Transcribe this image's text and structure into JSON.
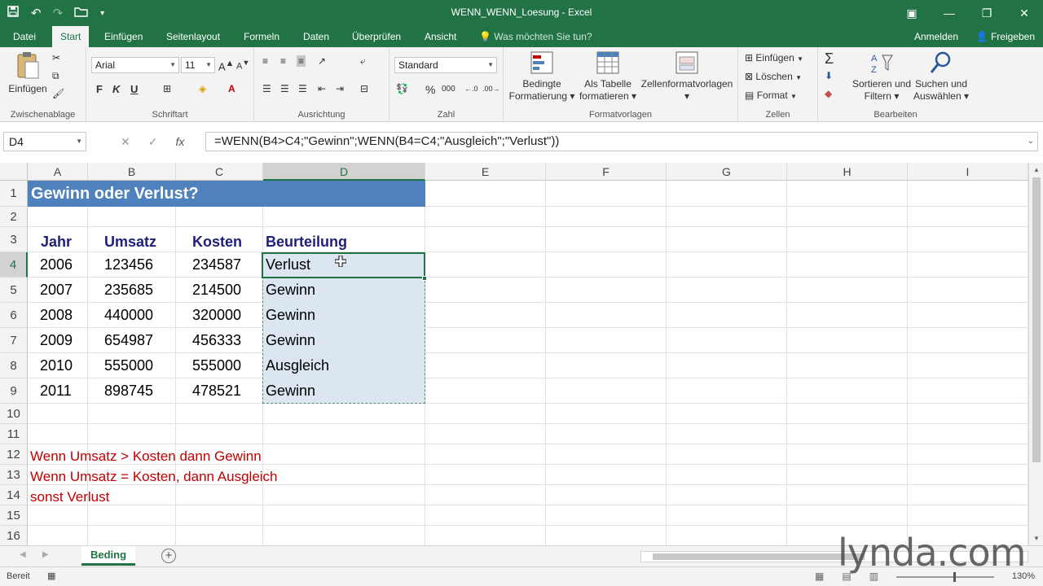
{
  "window": {
    "title": "WENN_WENN_Loesung - Excel",
    "qat": {
      "save_icon": "save-icon",
      "undo_icon": "undo-icon",
      "redo_icon": "redo-icon",
      "open_icon": "open-folder-icon",
      "customize_icon": "customize-icon"
    }
  },
  "ribbon_tabs": [
    "Datei",
    "Start",
    "Einfügen",
    "Seitenlayout",
    "Formeln",
    "Daten",
    "Überprüfen",
    "Ansicht"
  ],
  "active_tab": "Start",
  "tell_me": "Was möchten Sie tun?",
  "account": {
    "signin": "Anmelden",
    "share": "Freigeben"
  },
  "ribbon": {
    "clipboard": {
      "paste": "Einfügen",
      "label": "Zwischenablage"
    },
    "font": {
      "name": "Arial",
      "size": "11",
      "label": "Schriftart",
      "bold": "F",
      "italic": "K",
      "underline": "U"
    },
    "alignment": {
      "label": "Ausrichtung"
    },
    "number": {
      "format": "Standard",
      "label": "Zahl",
      "percent": "%",
      "thousands": "000"
    },
    "styles": {
      "conditional": "Bedingte Formatierung",
      "conditional_1": "Bedingte",
      "conditional_2": "Formatierung",
      "table_1": "Als Tabelle",
      "table_2": "formatieren",
      "cellstyles": "Zellenformatvorlagen",
      "label": "Formatvorlagen"
    },
    "cells": {
      "insert": "Einfügen",
      "delete": "Löschen",
      "format": "Format",
      "label": "Zellen"
    },
    "editing": {
      "sort_1": "Sortieren und",
      "sort_2": "Filtern",
      "find_1": "Suchen und",
      "find_2": "Auswählen",
      "label": "Bearbeiten"
    }
  },
  "formula_bar": {
    "name_box": "D4",
    "formula": "=WENN(B4>C4;\"Gewinn\";WENN(B4=C4;\"Ausgleich\";\"Verlust\"))",
    "cancel": "✕",
    "enter": "✓",
    "fx": "fx"
  },
  "columns": [
    "A",
    "B",
    "C",
    "D",
    "E",
    "F",
    "G",
    "H",
    "I"
  ],
  "rows": [
    "1",
    "2",
    "3",
    "4",
    "5",
    "6",
    "7",
    "8",
    "9",
    "10",
    "11",
    "12",
    "13",
    "14",
    "15",
    "16"
  ],
  "sheet": {
    "title": "Gewinn oder Verlust?",
    "headers": [
      "Jahr",
      "Umsatz",
      "Kosten",
      "Beurteilung"
    ],
    "data": [
      [
        "2006",
        "123456",
        "234587",
        "Verlust"
      ],
      [
        "2007",
        "235685",
        "214500",
        "Gewinn"
      ],
      [
        "2008",
        "440000",
        "320000",
        "Gewinn"
      ],
      [
        "2009",
        "654987",
        "456333",
        "Gewinn"
      ],
      [
        "2010",
        "555000",
        "555000",
        "Ausgleich"
      ],
      [
        "2011",
        "898745",
        "478521",
        "Gewinn"
      ]
    ],
    "notes": [
      "Wenn Umsatz > Kosten dann Gewinn",
      "Wenn Umsatz = Kosten, dann Ausgleich",
      "sonst Verlust"
    ]
  },
  "sheet_tabs": [
    "Beding"
  ],
  "status": {
    "ready": "Bereit",
    "zoom": "130%"
  },
  "watermark": "lynda.com",
  "colors": {
    "excel_green": "#217346",
    "title_band": "#4f81bd",
    "header_text": "#1f1f7a",
    "note_text": "#c00000"
  }
}
